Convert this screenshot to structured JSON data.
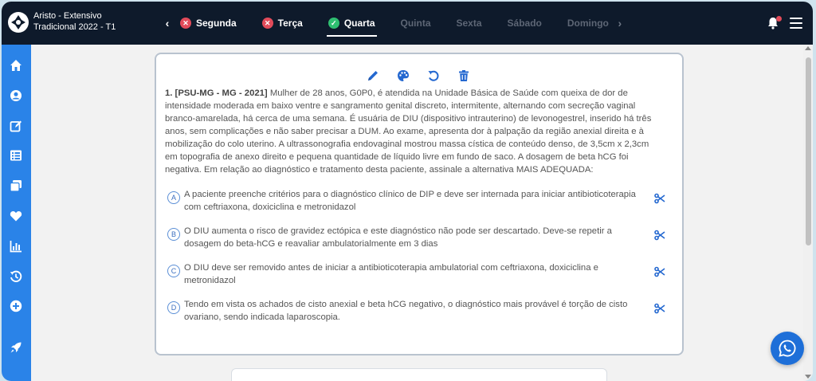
{
  "header": {
    "course_line1": "Aristo - Extensivo",
    "course_line2": "Tradicional 2022 - T1",
    "days": [
      {
        "label": "Segunda",
        "status": "incomplete"
      },
      {
        "label": "Terça",
        "status": "incomplete"
      },
      {
        "label": "Quarta",
        "status": "done",
        "active": true
      },
      {
        "label": "Quinta",
        "status": "none"
      },
      {
        "label": "Sexta",
        "status": "none"
      },
      {
        "label": "Sábado",
        "status": "none"
      },
      {
        "label": "Domingo",
        "status": "none"
      }
    ]
  },
  "sidebar": {
    "items": [
      "home-icon",
      "user-icon",
      "edit-icon",
      "list-icon",
      "cards-icon",
      "heart-icon",
      "chart-icon",
      "history-icon",
      "plus-icon",
      "rocket-icon"
    ]
  },
  "toolbar": {
    "icons": [
      "pencil-icon",
      "palette-icon",
      "undo-icon",
      "trash-icon"
    ]
  },
  "question": {
    "source": "1. [PSU-MG - MG - 2021]",
    "text": "Mulher de 28 anos, G0P0, é atendida na Unidade Básica de Saúde com queixa de dor de intensidade moderada em baixo ventre e sangramento genital discreto, intermitente, alternando com secreção vaginal branco-amarelada, há cerca de uma semana. É usuária de DIU (dispositivo intrauterino) de levonogestrel, inserido há três anos, sem complicações e não saber precisar a DUM. Ao exame, apresenta dor à palpação da região anexial direita e à mobilização do colo uterino. A ultrassonografia endovaginal mostrou massa cística de conteúdo denso, de 3,5cm x 2,3cm em topografia de anexo direito e pequena quantidade de líquido livre em fundo de saco. A dosagem de beta hCG foi negativa. Em relação ao diagnóstico e tratamento desta paciente, assinale a alternativa MAIS ADEQUADA:",
    "options": [
      {
        "letter": "A",
        "text": "A paciente preenche critérios para o diagnóstico clínico de DIP e deve ser internada para iniciar antibioticoterapia com ceftriaxona, doxiciclina e metronidazol"
      },
      {
        "letter": "B",
        "text": "O DIU aumenta o risco de gravidez ectópica e este diagnóstico não pode ser descartado. Deve-se repetir a dosagem do beta-hCG e reavaliar ambulatorialmente em 3 dias"
      },
      {
        "letter": "C",
        "text": "O DIU deve ser removido antes de iniciar a antibioticoterapia ambulatorial com ceftriaxona, doxiciclina e metronidazol"
      },
      {
        "letter": "D",
        "text": "Tendo em vista os achados de cisto anexial e beta hCG negativo, o diagnóstico mais provável é torção de cisto ovariano, sendo indicada laparoscopia."
      }
    ]
  },
  "colors": {
    "topbar": "#0e1a2b",
    "sidebar": "#2a83e8",
    "accent": "#1e6fd8",
    "incomplete": "#e24b5a",
    "done": "#2fbf71"
  }
}
